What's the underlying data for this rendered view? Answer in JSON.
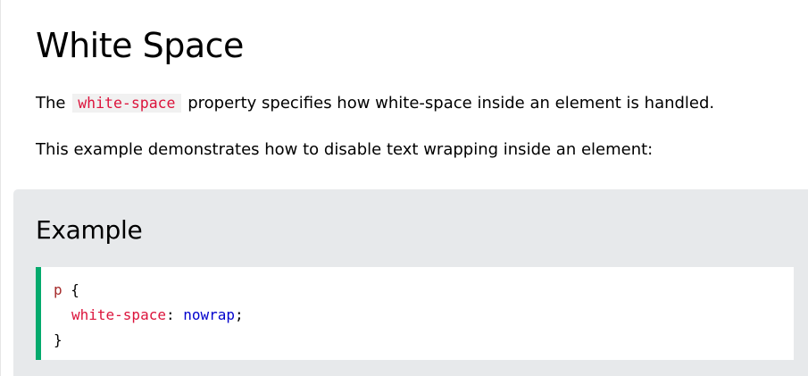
{
  "page": {
    "title": "White Space",
    "intro": {
      "prefix": "The",
      "code": "white-space",
      "suffix": "property specifies how white-space inside an element is handled."
    },
    "description": "This example demonstrates how to disable text wrapping inside an element:"
  },
  "example": {
    "heading": "Example",
    "code": {
      "selector": "p",
      "open_brace": "{",
      "property": "white-space",
      "colon": ":",
      "value": "nowrap",
      "semicolon": ";",
      "close_brace": "}"
    },
    "accent_color": "#04aa6d",
    "panel_color": "#e7e9eb"
  },
  "colors": {
    "inline_code": "#dc143c",
    "selector": "#a52a2a",
    "property": "#dc143c",
    "value": "#0000cd"
  }
}
